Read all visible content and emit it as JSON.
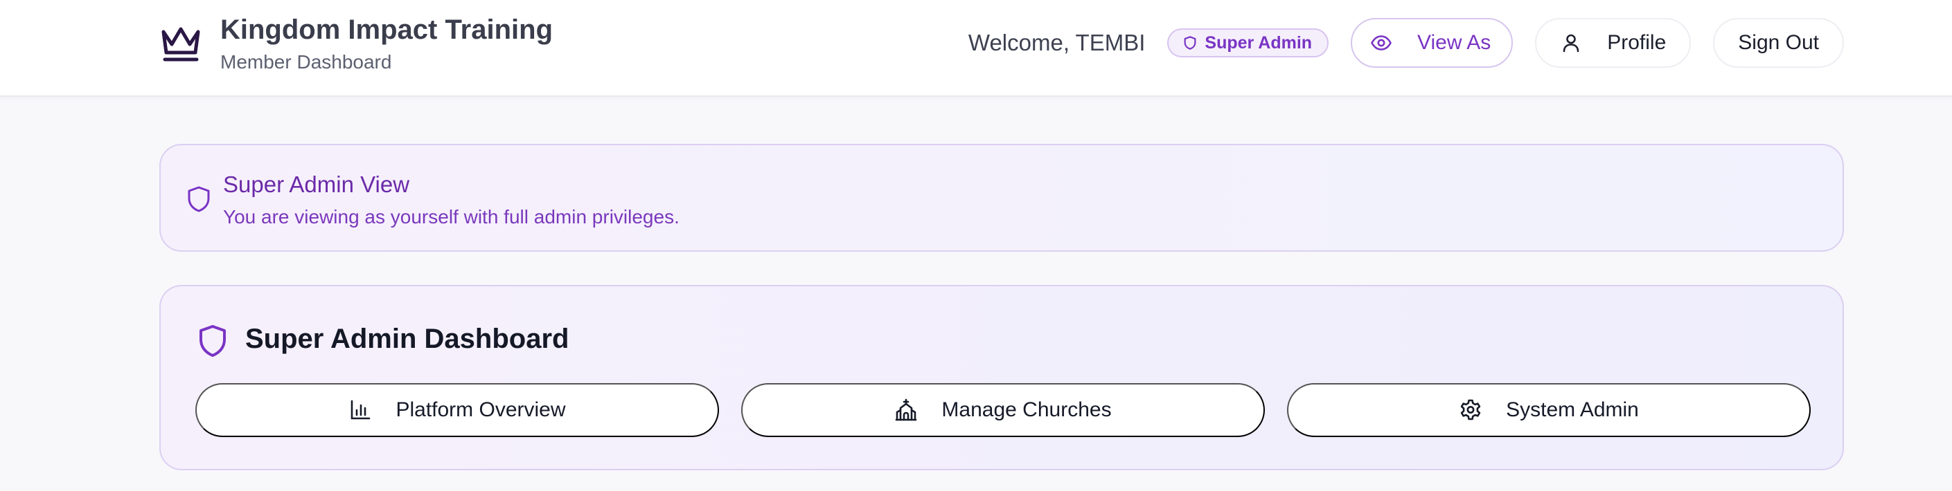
{
  "header": {
    "title": "Kingdom Impact Training",
    "subtitle": "Member Dashboard",
    "logo_icon": "crown-icon",
    "welcome": "Welcome, TEMBI",
    "role_badge": "Super Admin",
    "view_as_label": "View As",
    "profile_label": "Profile",
    "sign_out_label": "Sign Out"
  },
  "banner": {
    "title": "Super Admin View",
    "text": "You are viewing as yourself with full admin privileges.",
    "icon": "shield-icon"
  },
  "dashboard": {
    "title": "Super Admin Dashboard",
    "icon": "shield-icon",
    "buttons": [
      {
        "label": "Platform Overview",
        "icon": "bar-chart-icon"
      },
      {
        "label": "Manage Churches",
        "icon": "church-icon"
      },
      {
        "label": "System Admin",
        "icon": "gear-icon"
      }
    ]
  },
  "colors": {
    "accent": "#7a34c4",
    "accent_dark": "#6b2aa8",
    "logo": "#2a1745",
    "card_border": "#dccff2"
  }
}
